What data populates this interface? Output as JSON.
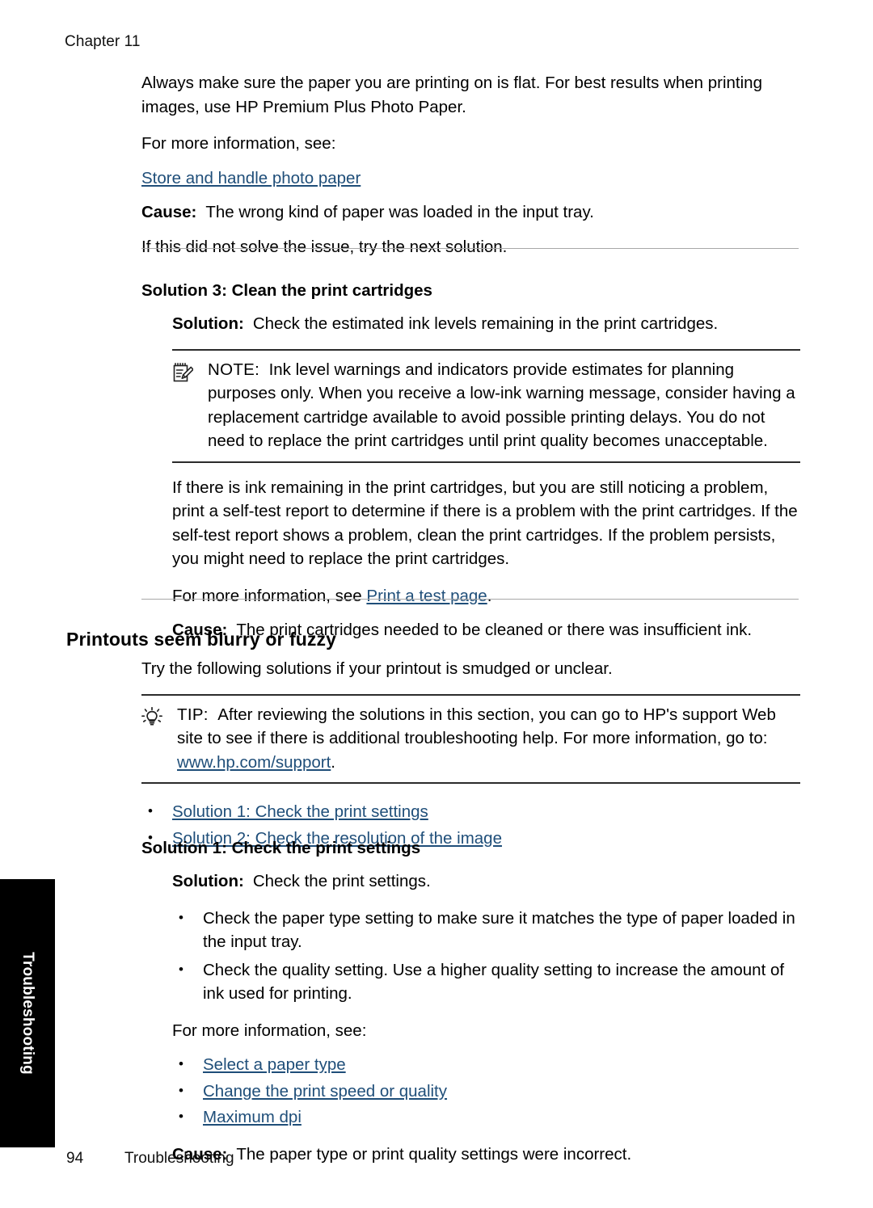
{
  "page": {
    "chapter_head": "Chapter 11",
    "footer_page_number": "94",
    "footer_section": "Troubleshooting",
    "thumb_tab": "Troubleshooting",
    "link_color": "#1f4e79"
  },
  "section_paper": {
    "para_flat": "Always make sure the paper you are printing on is flat. For best results when printing images, use HP Premium Plus Photo Paper.",
    "more_info": "For more information, see:",
    "link_store": "Store and handle photo paper",
    "cause_label": "Cause:",
    "cause_text": "The wrong kind of paper was loaded in the input tray.",
    "next_solution": "If this did not solve the issue, try the next solution."
  },
  "solution3": {
    "heading": "Solution 3: Clean the print cartridges",
    "solution_label": "Solution:",
    "solution_text": "Check the estimated ink levels remaining in the print cartridges.",
    "note": {
      "icon": "note-pad-pencil-icon",
      "keyword": "NOTE:",
      "text": "Ink level warnings and indicators provide estimates for planning purposes only. When you receive a low-ink warning message, consider having a replacement cartridge available to avoid possible printing delays. You do not need to replace the print cartridges until print quality becomes unacceptable."
    },
    "para_ink": "If there is ink remaining in the print cartridges, but you are still noticing a problem, print a self-test report to determine if there is a problem with the print cartridges. If the self-test report shows a problem, clean the print cartridges. If the problem persists, you might need to replace the print cartridges.",
    "more_info_prefix": "For more information, see ",
    "link_test_page": "Print a test page",
    "more_info_suffix": ".",
    "cause_label": "Cause:",
    "cause_text": "The print cartridges needed to be cleaned or there was insufficient ink."
  },
  "section_blurry": {
    "heading": "Printouts seem blurry or fuzzy",
    "intro": "Try the following solutions if your printout is smudged or unclear.",
    "tip": {
      "icon": "lightbulb-icon",
      "keyword": "TIP:",
      "text_before": "After reviewing the solutions in this section, you can go to HP's support Web site to see if there is additional troubleshooting help. For more information, go to: ",
      "link": "www.hp.com/support",
      "text_after": "."
    },
    "solution_links": [
      "Solution 1: Check the print settings",
      "Solution 2: Check the resolution of the image"
    ]
  },
  "solution1": {
    "heading": "Solution 1: Check the print settings",
    "solution_label": "Solution:",
    "solution_text": "Check the print settings.",
    "checks": [
      "Check the paper type setting to make sure it matches the type of paper loaded in the input tray.",
      "Check the quality setting. Use a higher quality setting to increase the amount of ink used for printing."
    ],
    "more_info": "For more information, see:",
    "more_info_links": [
      "Select a paper type",
      "Change the print speed or quality",
      "Maximum dpi"
    ],
    "cause_label": "Cause:",
    "cause_text": "The paper type or print quality settings were incorrect."
  }
}
